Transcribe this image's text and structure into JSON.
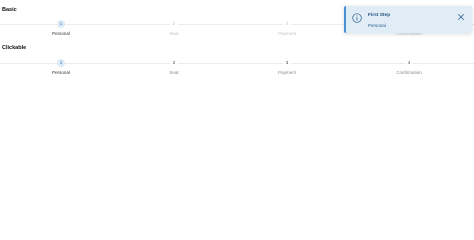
{
  "sections": {
    "basic": {
      "title": "Basic",
      "steps": [
        {
          "number": "1",
          "label": "Personal",
          "state": "active"
        },
        {
          "number": "2",
          "label": "Seat",
          "state": "inactive"
        },
        {
          "number": "3",
          "label": "Payment",
          "state": "inactive"
        },
        {
          "number": "4",
          "label": "Confirmation",
          "state": "inactive"
        }
      ]
    },
    "clickable": {
      "title": "Clickable",
      "steps": [
        {
          "number": "1",
          "label": "Personal",
          "state": "active"
        },
        {
          "number": "2",
          "label": "Seat",
          "state": "inactive"
        },
        {
          "number": "3",
          "label": "Payment",
          "state": "inactive"
        },
        {
          "number": "4",
          "label": "Confirmation",
          "state": "inactive"
        }
      ]
    }
  },
  "toast": {
    "title": "First Step",
    "detail": "Personal",
    "severity": "info",
    "icon": "info-circle-icon",
    "close_icon": "close-icon",
    "colors": {
      "background": "#e1edf6",
      "accent": "#4a90d6",
      "text": "#1f4f7c"
    }
  },
  "colors": {
    "active_step_bg": "#dcebf8",
    "active_step_text": "#3d6f9a",
    "inactive_text": "#c4c4c4"
  }
}
